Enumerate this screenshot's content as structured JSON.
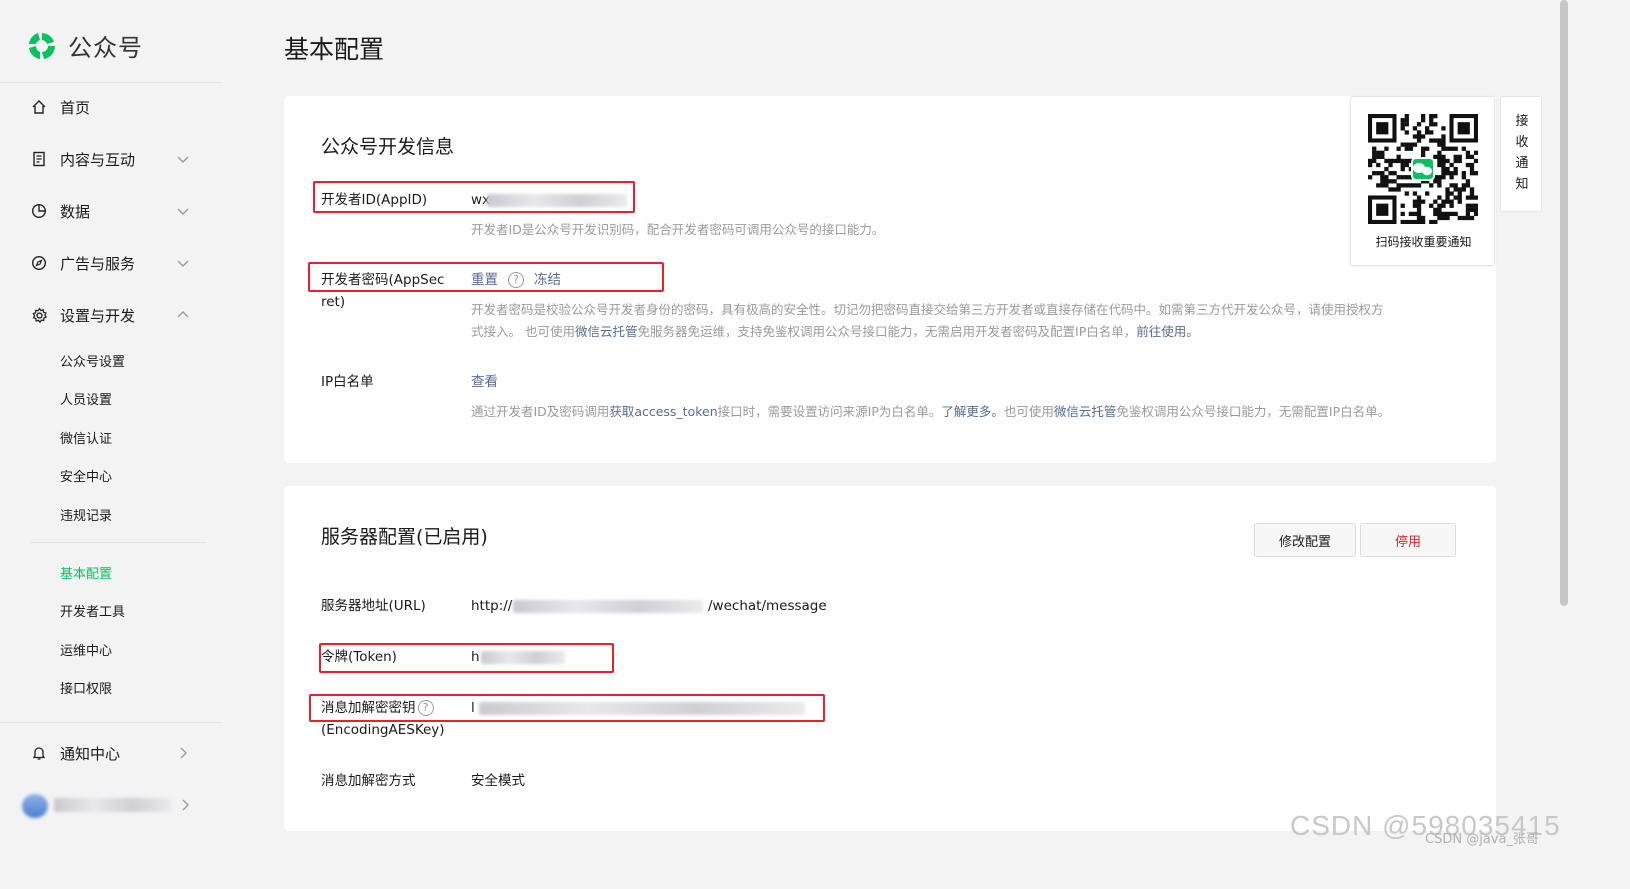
{
  "brand": {
    "name": "公众号"
  },
  "nav": {
    "home": "首页",
    "content": "内容与互动",
    "data": "数据",
    "ads": "广告与服务",
    "settings": "设置与开发",
    "sub": [
      "公众号设置",
      "人员设置",
      "微信认证",
      "安全中心",
      "违规记录"
    ],
    "sub2": [
      "基本配置",
      "开发者工具",
      "运维中心",
      "接口权限"
    ],
    "notify": "通知中心"
  },
  "page": {
    "title": "基本配置"
  },
  "dev_info": {
    "title": "公众号开发信息",
    "appid_label": "开发者ID(AppID)",
    "appid_value": "wx",
    "appid_desc": "开发者ID是公众号开发识别码，配合开发者密码可调用公众号的接口能力。",
    "secret_label_1": "开发者密码(AppSec",
    "secret_label_2": "ret)",
    "secret_reset": "重置",
    "secret_help": "?",
    "secret_freeze": "冻结",
    "secret_desc_1": "开发者密码是校验公众号开发者身份的密码，具有极高的安全性。切记勿把密码直接交给第三方开发者或直接存储在代码中。如需第三方代开发公众号，请使用授权方",
    "secret_desc_2a": "式接入。  也可使用",
    "secret_desc_2b": "微信云托管",
    "secret_desc_2c": "免服务器免运维，支持免鉴权调用公众号接口能力，无需启用开发者密码及配置IP白名单，",
    "secret_desc_2d": "前往使用。",
    "ip_label": "IP白名单",
    "ip_view": "查看",
    "ip_desc_a": "通过开发者ID及密码调用",
    "ip_desc_b": "获取access_token",
    "ip_desc_c": "接口时，需要设置访问来源IP为白名单。",
    "ip_desc_d": "了解更多。",
    "ip_desc_e": "也可使用",
    "ip_desc_f": "微信云托管",
    "ip_desc_g": "免鉴权调用公众号接口能力，无需配置IP白名单。"
  },
  "server": {
    "title": "服务器配置(已启用)",
    "modify_btn": "修改配置",
    "disable_btn": "停用",
    "url_label": "服务器地址(URL)",
    "url_prefix": "http://",
    "url_suffix": "/wechat/message",
    "token_label": "令牌(Token)",
    "token_value": "h",
    "aes_label_1": "消息加解密密钥",
    "aes_help": "?",
    "aes_label_2": "(EncodingAESKey)",
    "aes_value": "l",
    "mode_label": "消息加解密方式",
    "mode_value": "安全模式"
  },
  "qr": {
    "caption": "扫码接收重要通知"
  },
  "notify_strip": {
    "chars": [
      "接",
      "收",
      "通",
      "知"
    ]
  },
  "watermark": {
    "main": "CSDN @598035415",
    "sub": "CSDN @java_张哥"
  },
  "colors": {
    "accent": "#07c160",
    "link": "#576b95",
    "danger": "#e8202a"
  }
}
